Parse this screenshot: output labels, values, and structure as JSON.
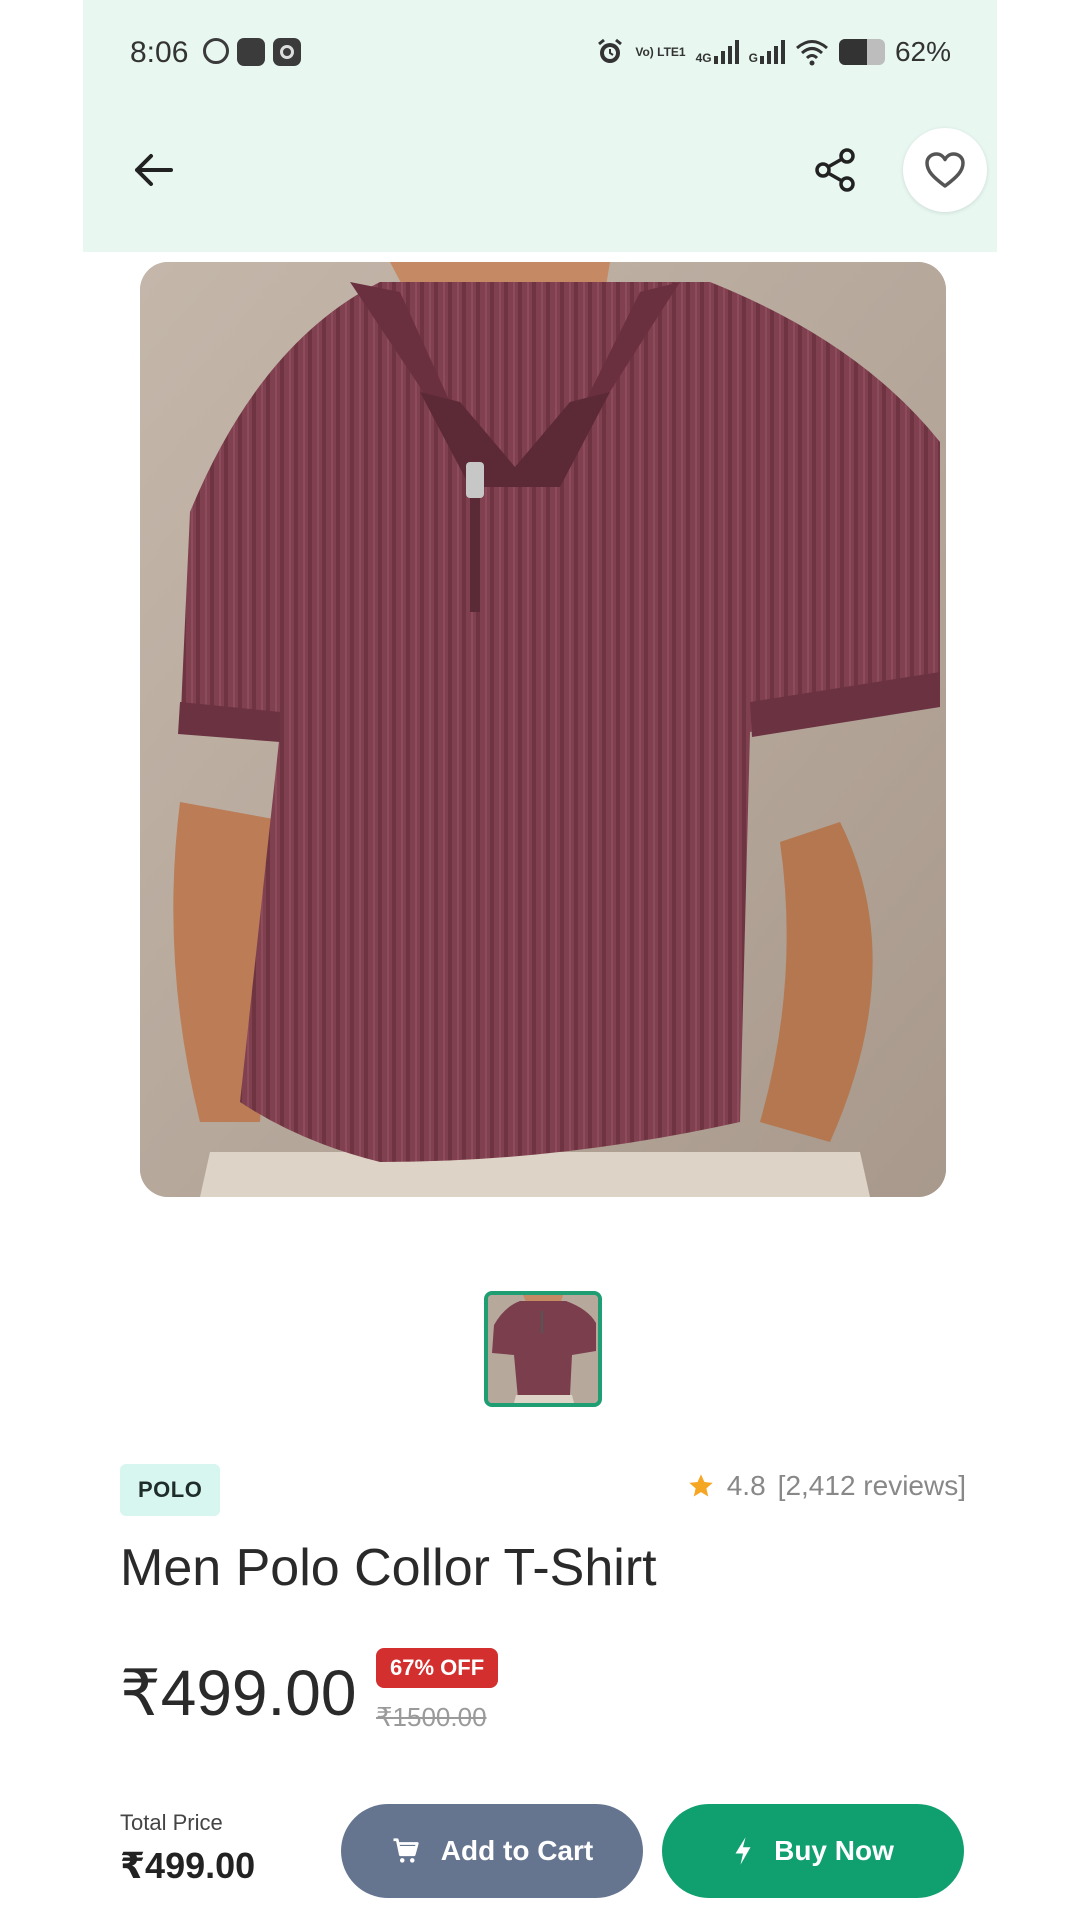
{
  "status_bar": {
    "time": "8:06",
    "network_1": "Vo) LTE1",
    "network_2": "4G",
    "network_3": "G",
    "battery": "62%",
    "battery_level": 0.62
  },
  "header": {
    "back_icon": "arrow-left-icon",
    "share_icon": "share-icon",
    "favorite_icon": "heart-outline-icon"
  },
  "product": {
    "category_tag": "POLO",
    "rating": "4.8",
    "reviews": "[2,412 reviews]",
    "title": "Men Polo Collor T-Shirt",
    "price": "₹499.00",
    "discount": "67% OFF",
    "original_price": "₹1500.00",
    "thumbnail_count": 1
  },
  "footer": {
    "total_label": "Total Price",
    "total_value": "₹499.00",
    "add_to_cart": "Add to Cart",
    "buy_now": "Buy Now"
  },
  "colors": {
    "header_bg": "#e8f8f1",
    "accent_green": "#109f6f",
    "cart_button": "#657590",
    "discount_red": "#d32f2f",
    "star": "#f5a623"
  }
}
